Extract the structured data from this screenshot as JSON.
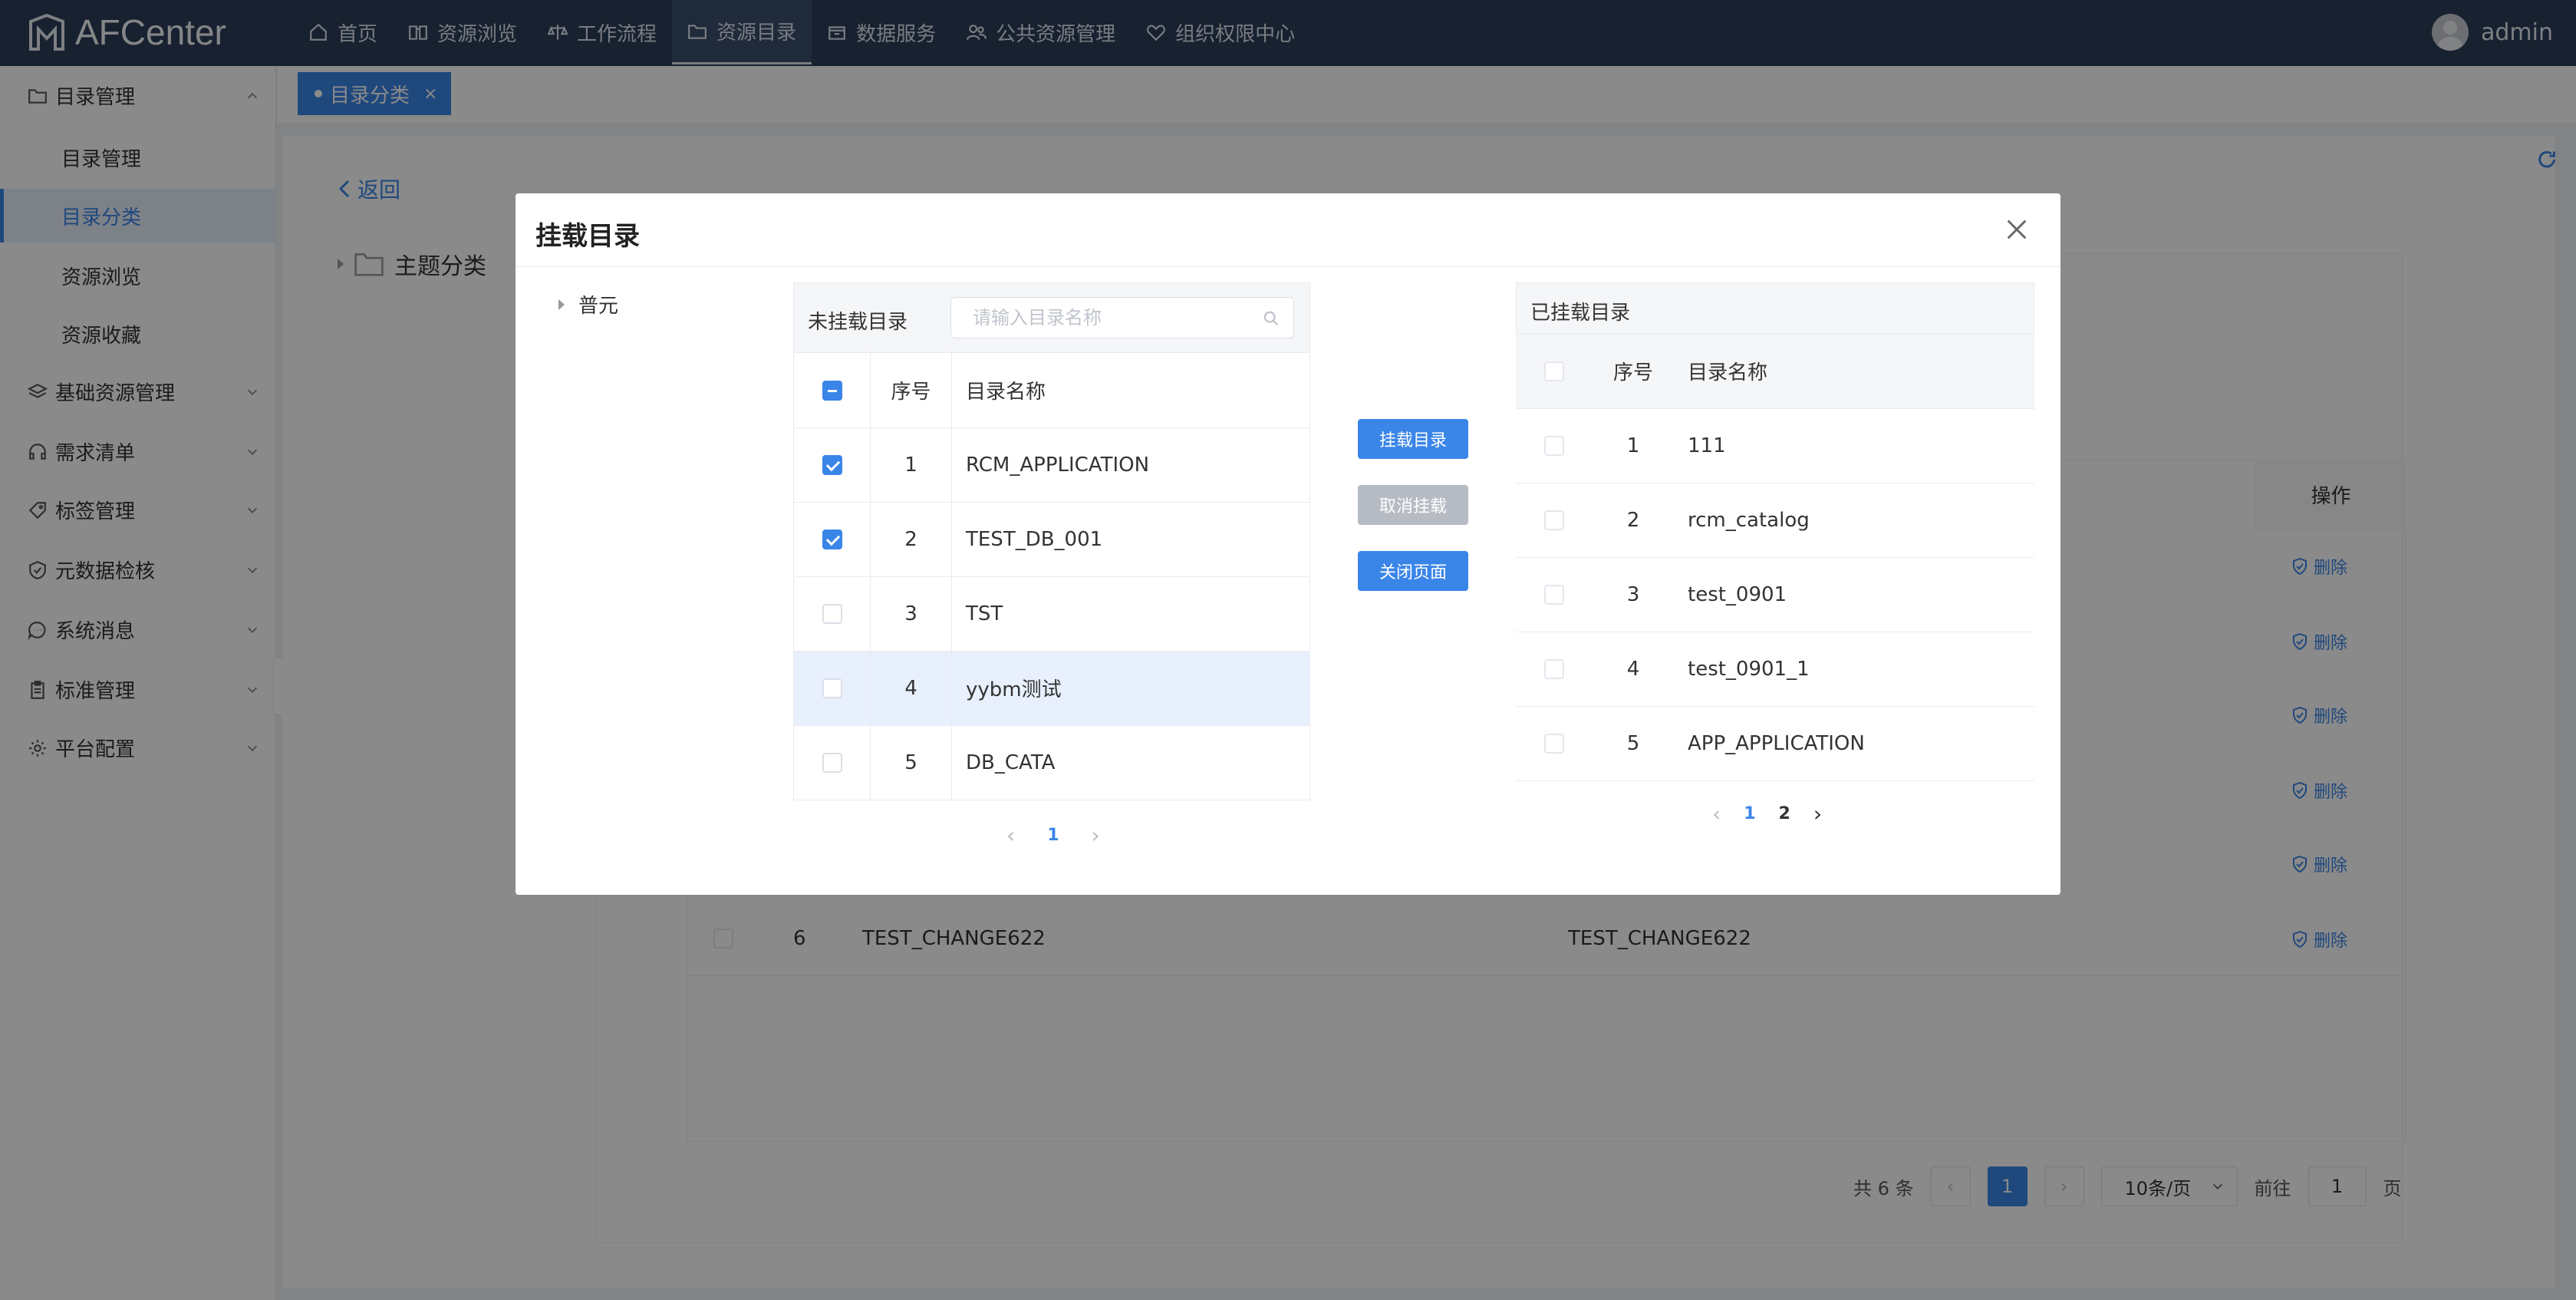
{
  "app": {
    "name": "AFCenter"
  },
  "nav": [
    {
      "label": "首页",
      "icon": "home-icon"
    },
    {
      "label": "资源浏览",
      "icon": "book-icon"
    },
    {
      "label": "工作流程",
      "icon": "scale-icon"
    },
    {
      "label": "资源目录",
      "icon": "folder-icon",
      "active": true
    },
    {
      "label": "数据服务",
      "icon": "box-icon"
    },
    {
      "label": "公共资源管理",
      "icon": "users-icon"
    },
    {
      "label": "组织权限中心",
      "icon": "heart-shield-icon"
    }
  ],
  "user": {
    "name": "admin"
  },
  "sidebar": {
    "group_open": {
      "label": "目录管理",
      "icon": "folder-icon"
    },
    "sub_items": [
      {
        "label": "目录管理"
      },
      {
        "label": "目录分类",
        "active": true
      },
      {
        "label": "资源浏览"
      },
      {
        "label": "资源收藏"
      }
    ],
    "groups": [
      {
        "label": "基础资源管理",
        "icon": "layers-icon"
      },
      {
        "label": "需求清单",
        "icon": "headset-icon"
      },
      {
        "label": "标签管理",
        "icon": "tag-icon"
      },
      {
        "label": "元数据检核",
        "icon": "shield-check-icon"
      },
      {
        "label": "系统消息",
        "icon": "chat-icon"
      },
      {
        "label": "标准管理",
        "icon": "clipboard-icon"
      },
      {
        "label": "平台配置",
        "icon": "gear-icon"
      }
    ]
  },
  "tabs": [
    {
      "label": "目录分类"
    }
  ],
  "page": {
    "back_label": "返回",
    "tree_root": "主题分类",
    "op_header": "操作",
    "delete_label": "删除",
    "row6": {
      "num": "6",
      "col1": "TEST_CHANGE622",
      "col2": "TEST_CHANGE622"
    },
    "pager": {
      "total": "共 6 条",
      "current": "1",
      "page_size": "10条/页",
      "goto_prefix": "前往",
      "goto_value": "1",
      "goto_suffix": "页"
    }
  },
  "modal": {
    "title": "挂载目录",
    "org_node": "普元",
    "left": {
      "title": "未挂载目录",
      "search_placeholder": "请输入目录名称",
      "col_num": "序号",
      "col_name": "目录名称",
      "rows": [
        {
          "num": "1",
          "name": "RCM_APPLICATION",
          "checked": true
        },
        {
          "num": "2",
          "name": "TEST_DB_001",
          "checked": true
        },
        {
          "num": "3",
          "name": "TST",
          "checked": false
        },
        {
          "num": "4",
          "name": "yybm测试",
          "checked": false
        },
        {
          "num": "5",
          "name": "DB_CATA",
          "checked": false
        }
      ],
      "pager": {
        "current": "1"
      }
    },
    "buttons": {
      "mount": "挂载目录",
      "unmount": "取消挂载",
      "close": "关闭页面"
    },
    "right": {
      "title": "已挂载目录",
      "col_num": "序号",
      "col_name": "目录名称",
      "rows": [
        {
          "num": "1",
          "name": "111"
        },
        {
          "num": "2",
          "name": "rcm_catalog"
        },
        {
          "num": "3",
          "name": "test_0901"
        },
        {
          "num": "4",
          "name": "test_0901_1"
        },
        {
          "num": "5",
          "name": "APP_APPLICATION"
        }
      ],
      "pager": {
        "current": "1",
        "next": "2"
      }
    }
  },
  "colors": {
    "primary": "#3a85e8",
    "topbar": "#2b3d5a",
    "disabled": "#b7bcc4"
  }
}
